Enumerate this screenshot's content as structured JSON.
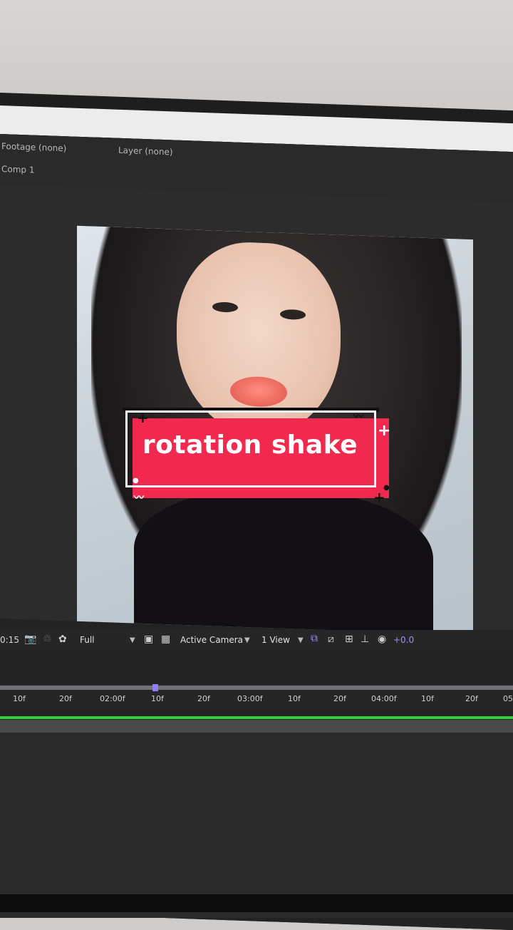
{
  "panels": {
    "footage_tab": "Footage (none)",
    "layer_tab": "Layer (none)",
    "comp_tab": "Comp 1"
  },
  "overlay": {
    "title": "rotation shake"
  },
  "viewer_toolbar": {
    "timecode": "0:15",
    "resolution": "Full",
    "view": "Active Camera",
    "layout": "1 View",
    "exposure": "+0.0"
  },
  "timeline": {
    "ticks": [
      "10f",
      "20f",
      "02:00f",
      "10f",
      "20f",
      "03:00f",
      "10f",
      "20f",
      "04:00f",
      "10f",
      "20f",
      "05"
    ]
  },
  "colors": {
    "title_box": "#f2294e",
    "playhead": "#8f7cf0",
    "work_area": "#35d135"
  }
}
